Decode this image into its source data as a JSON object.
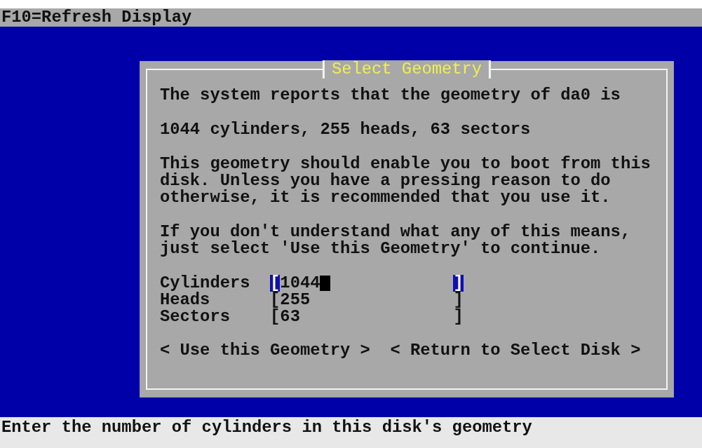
{
  "header": {
    "hint": "F10=Refresh Display"
  },
  "dialog": {
    "title": "Select Geometry",
    "paragraphs": [
      "The system reports that the geometry of da0 is",
      "1044 cylinders, 255 heads, 63 sectors",
      "This geometry should enable you to boot from this\ndisk. Unless you have a pressing reason to do\notherwise, it is recommended that you use it.",
      "If you don't understand what any of this means,\njust select 'Use this Geometry' to continue."
    ],
    "fields": [
      {
        "label": "Cylinders",
        "open": "[",
        "value": "1044",
        "close": "]",
        "focused": true
      },
      {
        "label": "Heads",
        "open": "[",
        "value": "255",
        "close": "]",
        "focused": false
      },
      {
        "label": "Sectors",
        "open": "[",
        "value": "63",
        "close": "]",
        "focused": false
      }
    ],
    "buttons": [
      "< Use this Geometry >",
      "< Return to Select Disk >"
    ]
  },
  "status_bar": {
    "text": "Enter the number of cylinders in this disk's geometry"
  }
}
